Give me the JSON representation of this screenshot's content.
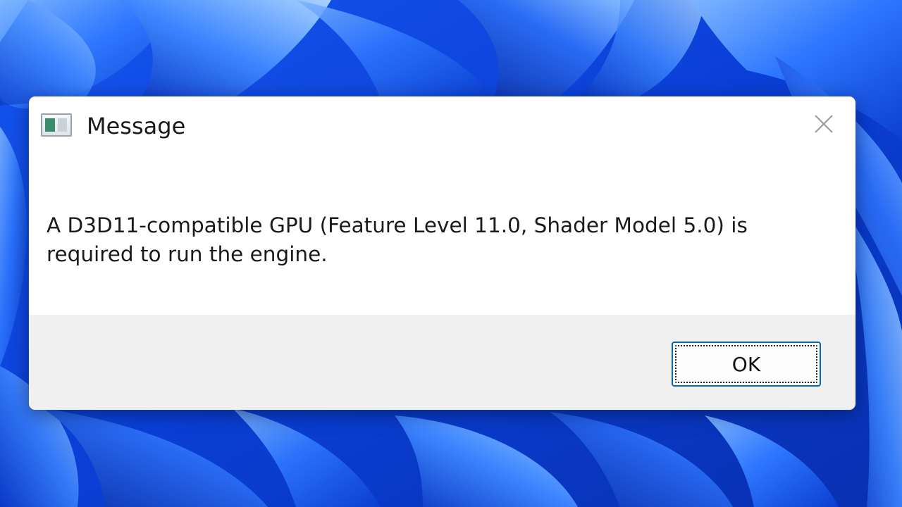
{
  "window": {
    "title": "Message",
    "icon": "application-window-icon",
    "close_icon": "close-icon"
  },
  "message": {
    "line1": "A D3D11-compatible GPU (Feature Level 11.0, Shader Model 5.0) is",
    "line2": "required to run the engine."
  },
  "buttons": {
    "ok_label": "OK"
  },
  "colors": {
    "wallpaper_blue": "#0a3fd6",
    "dialog_background": "#ffffff",
    "button_bar_background": "#f0f0f0",
    "ok_button_border": "#0067c0"
  }
}
